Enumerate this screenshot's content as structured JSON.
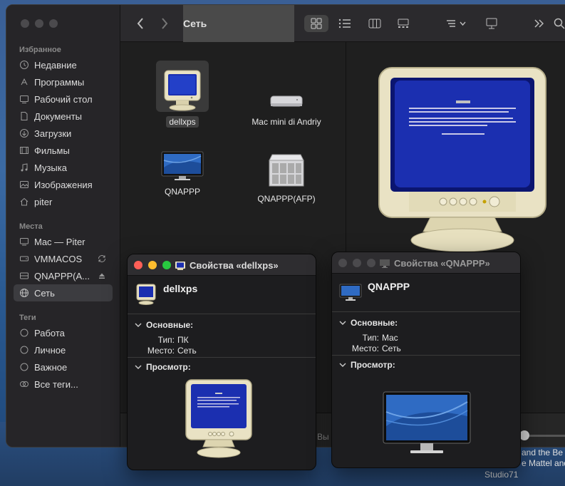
{
  "finder": {
    "title": "Сеть",
    "sidebar": {
      "favorites_header": "Избранное",
      "favorites": [
        {
          "label": "Недавние",
          "icon": "clock-icon"
        },
        {
          "label": "Программы",
          "icon": "apps-icon"
        },
        {
          "label": "Рабочий стол",
          "icon": "desktop-icon"
        },
        {
          "label": "Документы",
          "icon": "document-icon"
        },
        {
          "label": "Загрузки",
          "icon": "download-icon"
        },
        {
          "label": "Фильмы",
          "icon": "film-icon"
        },
        {
          "label": "Музыка",
          "icon": "music-icon"
        },
        {
          "label": "Изображения",
          "icon": "photo-icon"
        },
        {
          "label": "piter",
          "icon": "home-icon"
        }
      ],
      "places_header": "Места",
      "places": [
        {
          "label": "Mac — Piter",
          "icon": "computer-icon"
        },
        {
          "label": "VMMACOS",
          "icon": "drive-icon"
        },
        {
          "label": "QNAPPP(A...",
          "icon": "server-icon"
        },
        {
          "label": "Сеть",
          "icon": "globe-icon"
        }
      ],
      "tags_header": "Теги",
      "tags": [
        {
          "label": "Работа"
        },
        {
          "label": "Личное"
        },
        {
          "label": "Важное"
        },
        {
          "label": "Все теги..."
        }
      ]
    },
    "items": [
      {
        "label": "dellxps",
        "selected": true
      },
      {
        "label": "Mac mini di Andriy",
        "selected": false
      },
      {
        "label": "QNAPPP",
        "selected": false
      },
      {
        "label": "QNAPPP(AFP)",
        "selected": false
      }
    ]
  },
  "info_dellxps": {
    "title": "Свойства «dellxps»",
    "name": "dellxps",
    "general_header": "Основные:",
    "type_key": "Тип:",
    "type_value": "ПК",
    "where_key": "Место:",
    "where_value": "Сеть",
    "preview_header": "Просмотр:"
  },
  "info_qnappp": {
    "title": "Свойства «QNAPPP»",
    "name": "QNAPPP",
    "general_header": "Основные:",
    "type_key": "Тип:",
    "type_value": "Mac",
    "where_key": "Место:",
    "where_value": "Сеть",
    "preview_header": "Просмотр:"
  },
  "background": {
    "text1": "and the Be",
    "text2": "e Mattel and",
    "text3": "Studio71",
    "text4": "Вы"
  },
  "colors": {
    "close": "#ff5f57",
    "minimize": "#febc2e",
    "zoom": "#28c840",
    "bsod_blue": "#1b2fb0",
    "monitor_beige": "#e9e2c4"
  }
}
